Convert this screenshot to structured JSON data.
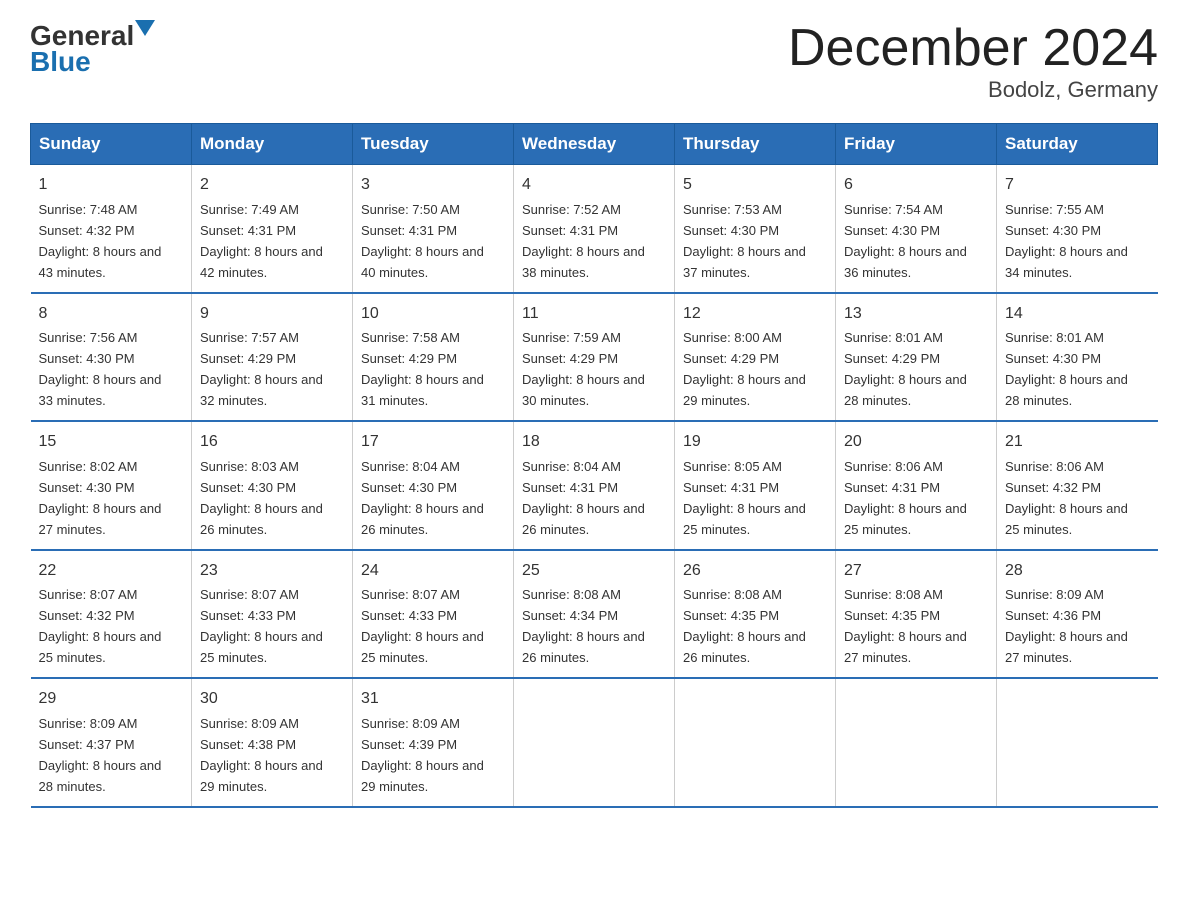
{
  "header": {
    "logo_general": "General",
    "logo_blue": "Blue",
    "month_title": "December 2024",
    "location": "Bodolz, Germany"
  },
  "weekdays": [
    "Sunday",
    "Monday",
    "Tuesday",
    "Wednesday",
    "Thursday",
    "Friday",
    "Saturday"
  ],
  "weeks": [
    [
      {
        "day": "1",
        "sunrise": "7:48 AM",
        "sunset": "4:32 PM",
        "daylight": "8 hours and 43 minutes."
      },
      {
        "day": "2",
        "sunrise": "7:49 AM",
        "sunset": "4:31 PM",
        "daylight": "8 hours and 42 minutes."
      },
      {
        "day": "3",
        "sunrise": "7:50 AM",
        "sunset": "4:31 PM",
        "daylight": "8 hours and 40 minutes."
      },
      {
        "day": "4",
        "sunrise": "7:52 AM",
        "sunset": "4:31 PM",
        "daylight": "8 hours and 38 minutes."
      },
      {
        "day": "5",
        "sunrise": "7:53 AM",
        "sunset": "4:30 PM",
        "daylight": "8 hours and 37 minutes."
      },
      {
        "day": "6",
        "sunrise": "7:54 AM",
        "sunset": "4:30 PM",
        "daylight": "8 hours and 36 minutes."
      },
      {
        "day": "7",
        "sunrise": "7:55 AM",
        "sunset": "4:30 PM",
        "daylight": "8 hours and 34 minutes."
      }
    ],
    [
      {
        "day": "8",
        "sunrise": "7:56 AM",
        "sunset": "4:30 PM",
        "daylight": "8 hours and 33 minutes."
      },
      {
        "day": "9",
        "sunrise": "7:57 AM",
        "sunset": "4:29 PM",
        "daylight": "8 hours and 32 minutes."
      },
      {
        "day": "10",
        "sunrise": "7:58 AM",
        "sunset": "4:29 PM",
        "daylight": "8 hours and 31 minutes."
      },
      {
        "day": "11",
        "sunrise": "7:59 AM",
        "sunset": "4:29 PM",
        "daylight": "8 hours and 30 minutes."
      },
      {
        "day": "12",
        "sunrise": "8:00 AM",
        "sunset": "4:29 PM",
        "daylight": "8 hours and 29 minutes."
      },
      {
        "day": "13",
        "sunrise": "8:01 AM",
        "sunset": "4:29 PM",
        "daylight": "8 hours and 28 minutes."
      },
      {
        "day": "14",
        "sunrise": "8:01 AM",
        "sunset": "4:30 PM",
        "daylight": "8 hours and 28 minutes."
      }
    ],
    [
      {
        "day": "15",
        "sunrise": "8:02 AM",
        "sunset": "4:30 PM",
        "daylight": "8 hours and 27 minutes."
      },
      {
        "day": "16",
        "sunrise": "8:03 AM",
        "sunset": "4:30 PM",
        "daylight": "8 hours and 26 minutes."
      },
      {
        "day": "17",
        "sunrise": "8:04 AM",
        "sunset": "4:30 PM",
        "daylight": "8 hours and 26 minutes."
      },
      {
        "day": "18",
        "sunrise": "8:04 AM",
        "sunset": "4:31 PM",
        "daylight": "8 hours and 26 minutes."
      },
      {
        "day": "19",
        "sunrise": "8:05 AM",
        "sunset": "4:31 PM",
        "daylight": "8 hours and 25 minutes."
      },
      {
        "day": "20",
        "sunrise": "8:06 AM",
        "sunset": "4:31 PM",
        "daylight": "8 hours and 25 minutes."
      },
      {
        "day": "21",
        "sunrise": "8:06 AM",
        "sunset": "4:32 PM",
        "daylight": "8 hours and 25 minutes."
      }
    ],
    [
      {
        "day": "22",
        "sunrise": "8:07 AM",
        "sunset": "4:32 PM",
        "daylight": "8 hours and 25 minutes."
      },
      {
        "day": "23",
        "sunrise": "8:07 AM",
        "sunset": "4:33 PM",
        "daylight": "8 hours and 25 minutes."
      },
      {
        "day": "24",
        "sunrise": "8:07 AM",
        "sunset": "4:33 PM",
        "daylight": "8 hours and 25 minutes."
      },
      {
        "day": "25",
        "sunrise": "8:08 AM",
        "sunset": "4:34 PM",
        "daylight": "8 hours and 26 minutes."
      },
      {
        "day": "26",
        "sunrise": "8:08 AM",
        "sunset": "4:35 PM",
        "daylight": "8 hours and 26 minutes."
      },
      {
        "day": "27",
        "sunrise": "8:08 AM",
        "sunset": "4:35 PM",
        "daylight": "8 hours and 27 minutes."
      },
      {
        "day": "28",
        "sunrise": "8:09 AM",
        "sunset": "4:36 PM",
        "daylight": "8 hours and 27 minutes."
      }
    ],
    [
      {
        "day": "29",
        "sunrise": "8:09 AM",
        "sunset": "4:37 PM",
        "daylight": "8 hours and 28 minutes."
      },
      {
        "day": "30",
        "sunrise": "8:09 AM",
        "sunset": "4:38 PM",
        "daylight": "8 hours and 29 minutes."
      },
      {
        "day": "31",
        "sunrise": "8:09 AM",
        "sunset": "4:39 PM",
        "daylight": "8 hours and 29 minutes."
      },
      null,
      null,
      null,
      null
    ]
  ],
  "labels": {
    "sunrise": "Sunrise:",
    "sunset": "Sunset:",
    "daylight": "Daylight:"
  }
}
